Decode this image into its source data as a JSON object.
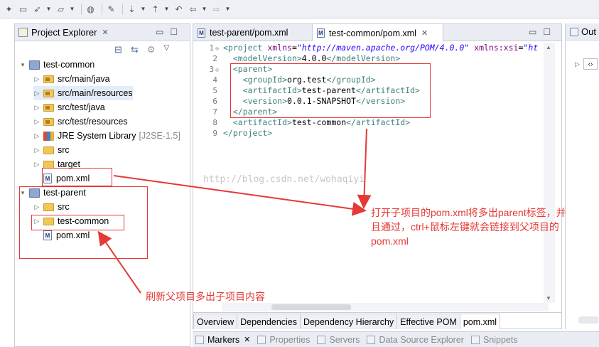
{
  "explorer": {
    "title": "Project Explorer",
    "tree": [
      {
        "label": "test-common",
        "suffix": "",
        "kind": "project",
        "expanded": true,
        "indent": 0
      },
      {
        "label": "src/main/java",
        "suffix": "",
        "kind": "package-folder",
        "expanded": false,
        "indent": 1
      },
      {
        "label": "src/main/resources",
        "suffix": "",
        "kind": "package-folder",
        "expanded": false,
        "indent": 1
      },
      {
        "label": "src/test/java",
        "suffix": "",
        "kind": "package-folder",
        "expanded": false,
        "indent": 1
      },
      {
        "label": "src/test/resources",
        "suffix": "",
        "kind": "package-folder",
        "expanded": false,
        "indent": 1
      },
      {
        "label": "JRE System Library",
        "suffix": "[J2SE-1.5]",
        "kind": "library",
        "expanded": false,
        "indent": 1
      },
      {
        "label": "src",
        "suffix": "",
        "kind": "folder",
        "expanded": false,
        "indent": 1
      },
      {
        "label": "target",
        "suffix": "",
        "kind": "folder",
        "expanded": false,
        "indent": 1
      },
      {
        "label": "pom.xml",
        "suffix": "",
        "kind": "pom",
        "expanded": null,
        "indent": 1
      },
      {
        "label": "test-parent",
        "suffix": "",
        "kind": "project",
        "expanded": true,
        "indent": 0
      },
      {
        "label": "src",
        "suffix": "",
        "kind": "folder",
        "expanded": false,
        "indent": 1
      },
      {
        "label": "test-common",
        "suffix": "",
        "kind": "folder",
        "expanded": false,
        "indent": 1
      },
      {
        "label": "pom.xml",
        "suffix": "",
        "kind": "pom",
        "expanded": null,
        "indent": 1
      }
    ]
  },
  "editor": {
    "tabs": [
      {
        "label": "test-parent/pom.xml",
        "active": false
      },
      {
        "label": "test-common/pom.xml",
        "active": true
      }
    ],
    "lines": [
      {
        "n": "1",
        "fold": true,
        "parts": [
          [
            "tag",
            "<project "
          ],
          [
            "attr",
            "xmlns"
          ],
          [
            "txt",
            "="
          ],
          [
            "val",
            "\"http://maven.apache.org/POM/4.0.0\""
          ],
          [
            "txt",
            " "
          ],
          [
            "attr",
            "xmlns:xsi"
          ],
          [
            "txt",
            "="
          ],
          [
            "val",
            "\"ht"
          ]
        ]
      },
      {
        "n": "2",
        "fold": false,
        "parts": [
          [
            "txt",
            "  "
          ],
          [
            "tag",
            "<modelVersion>"
          ],
          [
            "txt",
            "4.0.0"
          ],
          [
            "tag",
            "</modelVersion>"
          ]
        ]
      },
      {
        "n": "3",
        "fold": true,
        "parts": [
          [
            "txt",
            "  "
          ],
          [
            "tag",
            "<parent>"
          ]
        ]
      },
      {
        "n": "4",
        "fold": false,
        "parts": [
          [
            "txt",
            "    "
          ],
          [
            "tag",
            "<groupId>"
          ],
          [
            "txt",
            "org.test"
          ],
          [
            "tag",
            "</groupId>"
          ]
        ]
      },
      {
        "n": "5",
        "fold": false,
        "parts": [
          [
            "txt",
            "    "
          ],
          [
            "tag",
            "<artifactId>"
          ],
          [
            "txt",
            "test-parent"
          ],
          [
            "tag",
            "</artifactId>"
          ]
        ]
      },
      {
        "n": "6",
        "fold": false,
        "parts": [
          [
            "txt",
            "    "
          ],
          [
            "tag",
            "<version>"
          ],
          [
            "txt",
            "0.0.1-SNAPSHOT"
          ],
          [
            "tag",
            "</version>"
          ]
        ]
      },
      {
        "n": "7",
        "fold": false,
        "parts": [
          [
            "txt",
            "  "
          ],
          [
            "tag",
            "</parent>"
          ]
        ]
      },
      {
        "n": "8",
        "fold": false,
        "parts": [
          [
            "txt",
            "  "
          ],
          [
            "tag",
            "<artifactId>"
          ],
          [
            "txt",
            "test-common"
          ],
          [
            "tag",
            "</artifactId>"
          ]
        ]
      },
      {
        "n": "9",
        "fold": false,
        "parts": [
          [
            "tag",
            "</project>"
          ]
        ]
      }
    ],
    "page_tabs": [
      {
        "label": "Overview",
        "active": false
      },
      {
        "label": "Dependencies",
        "active": false
      },
      {
        "label": "Dependency Hierarchy",
        "active": false
      },
      {
        "label": "Effective POM",
        "active": false
      },
      {
        "label": "pom.xml",
        "active": true
      }
    ]
  },
  "outline": {
    "title": "Out"
  },
  "bottom_views": [
    {
      "label": "Markers",
      "active": true
    },
    {
      "label": "Properties",
      "active": false
    },
    {
      "label": "Servers",
      "active": false
    },
    {
      "label": "Data Source Explorer",
      "active": false
    },
    {
      "label": "Snippets",
      "active": false
    }
  ],
  "watermark": "http://blog.csdn.net/wohaqiyi",
  "annotations": {
    "note_right": [
      "打开子项目的pom.xml将多出parent标签，并",
      "且通过，ctrl+鼠标左键就会链接到父项目的",
      "pom.xml"
    ],
    "note_bottom": "刷新父项目多出子项目内容",
    "color": "#e53935"
  }
}
